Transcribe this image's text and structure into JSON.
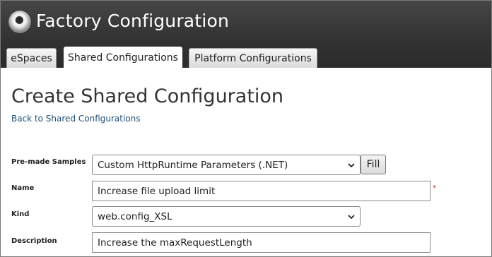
{
  "header": {
    "title": "Factory Configuration"
  },
  "tabs": [
    {
      "label": "eSpaces",
      "active": false
    },
    {
      "label": "Shared Configurations",
      "active": true
    },
    {
      "label": "Platform Configurations",
      "active": false
    }
  ],
  "main": {
    "title": "Create Shared Configuration",
    "back_link": "Back to Shared Configurations",
    "form": {
      "premade": {
        "label": "Pre-made Samples",
        "value": "Custom HttpRuntime Parameters (.NET)",
        "button": "Fill"
      },
      "name": {
        "label": "Name",
        "value": "Increase file upload limit",
        "required_marker": "*"
      },
      "kind": {
        "label": "Kind",
        "value": "web.config_XSL"
      },
      "description": {
        "label": "Description",
        "value": "Increase the maxRequestLength"
      }
    }
  },
  "colors": {
    "header_bg": "#333333",
    "link": "#1f4e79",
    "required": "#c0392b"
  },
  "icons": {
    "logo": "factory-logo-icon",
    "dropdown": "chevron-down-icon"
  }
}
